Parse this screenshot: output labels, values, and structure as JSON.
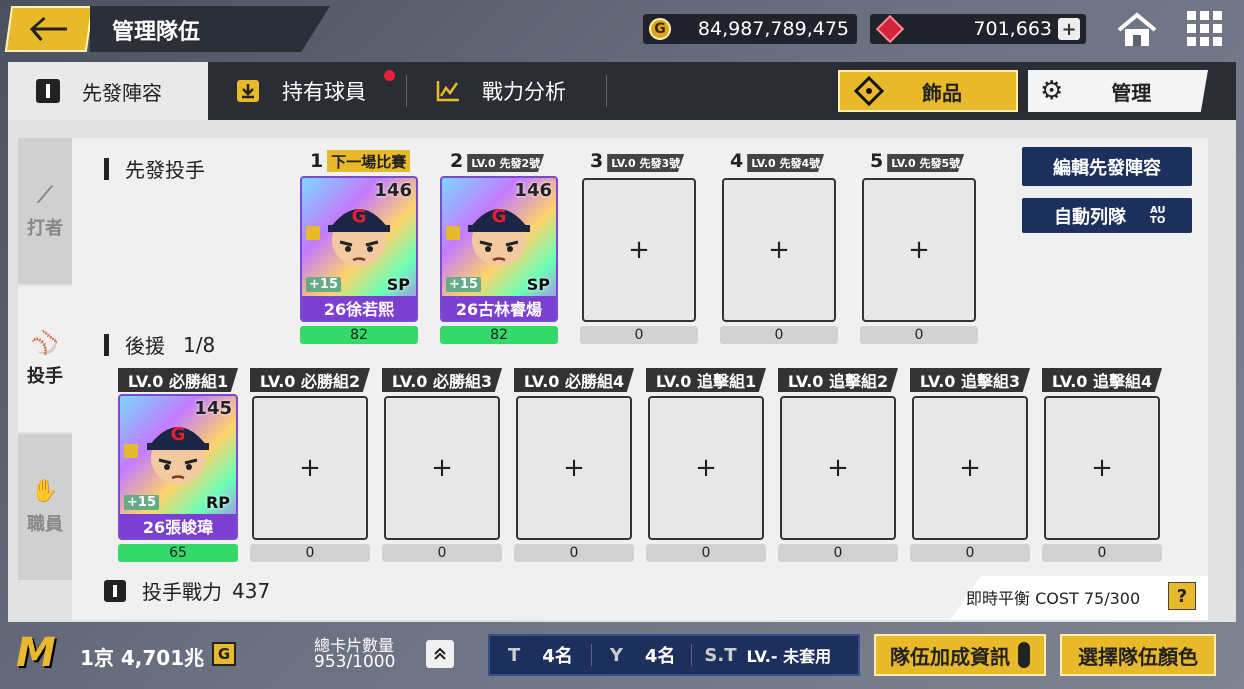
{
  "header": {
    "title": "管理隊伍",
    "gold": "84,987,789,475",
    "gems": "701,663",
    "gold_icon": "G"
  },
  "tabs": {
    "starting": "先發陣容",
    "owned": "持有球員",
    "analysis": "戰力分析",
    "accessory": "飾品",
    "manage": "管理"
  },
  "side": {
    "batter": "打者",
    "pitcher": "投手",
    "staff": "職員"
  },
  "starters": {
    "title": "先發投手",
    "slots": [
      {
        "num": "1",
        "tag": "下一場比賽",
        "card": {
          "name": "26徐若熙",
          "rating": "146",
          "pos": "SP",
          "bonus": "+15"
        },
        "value": "82"
      },
      {
        "num": "2",
        "tag": "LV.0 先發2號",
        "card": {
          "name": "26古林睿煬",
          "rating": "146",
          "pos": "SP",
          "bonus": "+15"
        },
        "value": "82"
      },
      {
        "num": "3",
        "tag": "LV.0 先發3號",
        "value": "0",
        "add": "+"
      },
      {
        "num": "4",
        "tag": "LV.0 先發4號",
        "value": "0",
        "add": "+"
      },
      {
        "num": "5",
        "tag": "LV.0 先發5號",
        "value": "0",
        "add": "+"
      }
    ]
  },
  "buttons": {
    "edit": "編輯先發陣容",
    "auto": "自動列隊",
    "auto_badge": "AU\nTO"
  },
  "relief": {
    "title": "後援",
    "count": "1/8",
    "slots": [
      {
        "tag": "LV.0 必勝組1",
        "card": {
          "name": "26張峻瑋",
          "rating": "145",
          "pos": "RP",
          "bonus": "+15"
        },
        "value": "65"
      },
      {
        "tag": "LV.0 必勝組2",
        "value": "0",
        "add": "+"
      },
      {
        "tag": "LV.0 必勝組3",
        "value": "0",
        "add": "+"
      },
      {
        "tag": "LV.0 必勝組4",
        "value": "0",
        "add": "+"
      },
      {
        "tag": "LV.0 追擊組1",
        "value": "0",
        "add": "+"
      },
      {
        "tag": "LV.0 追擊組2",
        "value": "0",
        "add": "+"
      },
      {
        "tag": "LV.0 追擊組3",
        "value": "0",
        "add": "+"
      },
      {
        "tag": "LV.0 追擊組4",
        "value": "0",
        "add": "+"
      }
    ]
  },
  "footer_panel": {
    "power_label": "投手戰力",
    "power_value": "437",
    "cost_text": "即時平衡 COST 75/300",
    "help": "?"
  },
  "bottom": {
    "logo": "M",
    "money": "1京 4,701兆",
    "money_icon": "G",
    "cards_label": "總卡片數量",
    "cards_value": "953/1000",
    "t_label": "T",
    "t_value": "4名",
    "y_label": "Y",
    "y_value": "4名",
    "st_label": "S.T",
    "st_value": "LV.- 未套用",
    "bonus_btn": "隊伍加成資訊",
    "color_btn": "選擇隊伍顏色"
  },
  "colors": {
    "accent": "#e8b92a",
    "navy": "#1d2f5c",
    "card_name_bg": "#7b3fd1",
    "value_green": "#34d96a"
  }
}
